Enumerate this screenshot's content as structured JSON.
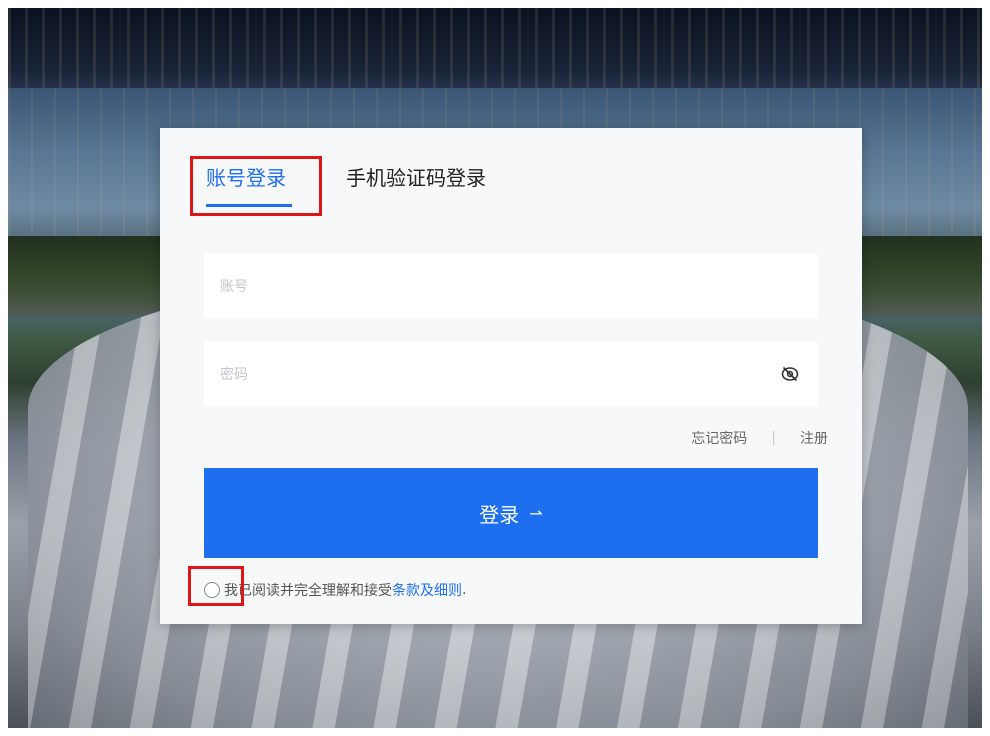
{
  "tabs": {
    "account_login": "账号登录",
    "sms_login": "手机验证码登录"
  },
  "form": {
    "account_placeholder": "账号",
    "password_placeholder": "密码",
    "forgot_password": "忘记密码",
    "separator": "|",
    "register": "注册",
    "login_button": "登录",
    "login_arrow": "⇀"
  },
  "agreement": {
    "text": "我已阅读并完全理解和接受",
    "terms_link": "条款及细则",
    "period": "."
  },
  "colors": {
    "accent": "#1e6ff0",
    "highlight_box": "#e01515"
  },
  "icons": {
    "password_toggle": "eye-off-icon"
  }
}
